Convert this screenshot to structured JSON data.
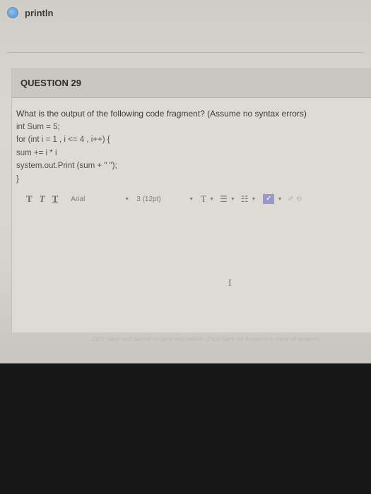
{
  "answer_option": {
    "label": "println"
  },
  "question": {
    "title": "QUESTION 29",
    "prompt": "What is the output of the following code fragment? (Assume no syntax errors)",
    "code": [
      "int Sum = 5;",
      "for (int i = 1 , i <= 4 , i++) {",
      "sum += i * i",
      "system.out.Print (sum + \" \");",
      "}"
    ]
  },
  "toolbar": {
    "bold": "T",
    "italic": "T",
    "underline": "T",
    "font": "Arial",
    "size": "3 (12pt)",
    "text_color": "T",
    "list_bulleted": "☰",
    "list_numbered": "☷",
    "spellcheck": "✓",
    "faded_tools": "✐ ⟲"
  },
  "footer": {
    "instructions": "Click Save and Submit to save and submit. Click Save All Answers to save all answers."
  }
}
